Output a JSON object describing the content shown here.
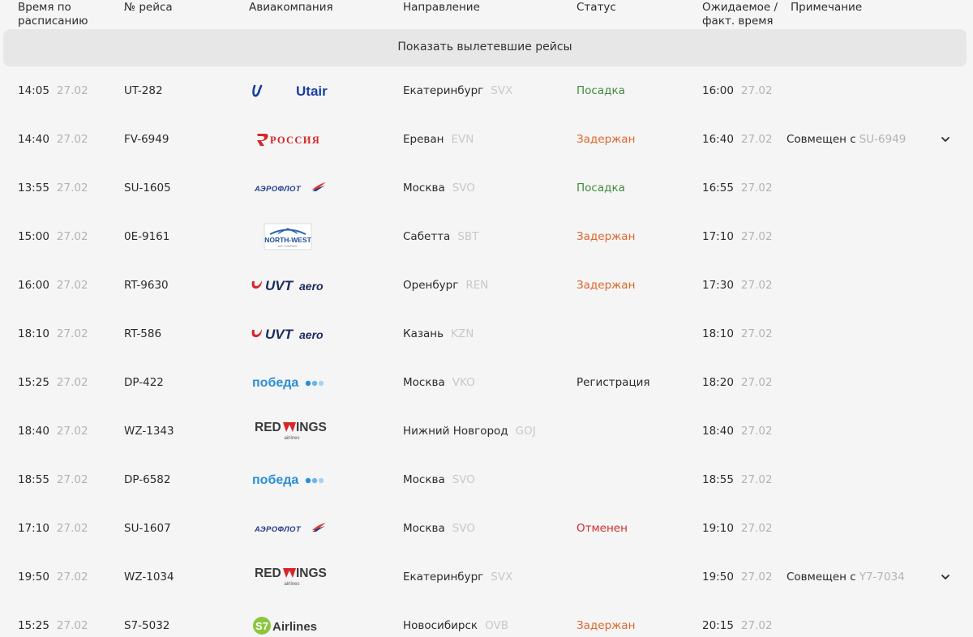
{
  "header": {
    "sched": [
      "Время по",
      "расписанию"
    ],
    "flight": "№ рейса",
    "airline": "Авиакомпания",
    "dest": "Направление",
    "status": "Статус",
    "actual": [
      "Ожидаемое /",
      "факт. время"
    ],
    "note": "Примечание"
  },
  "show_departed_label": "Показать вылетевшие рейсы",
  "colors": {
    "boarding": "#3f8a3a",
    "delayed": "#e0662a",
    "cancelled": "#d42a2a"
  },
  "rows": [
    {
      "time": "14:05",
      "date": "27.02",
      "flight": "UT-282",
      "airline": "Utair",
      "dest": "Екатеринбург",
      "code": "SVX",
      "status": "Посадка",
      "actual_time": "16:00",
      "actual_date": "27.02",
      "note": "",
      "note_code": ""
    },
    {
      "time": "14:40",
      "date": "27.02",
      "flight": "FV-6949",
      "airline": "Россия",
      "dest": "Ереван",
      "code": "EVN",
      "status": "Задержан",
      "actual_time": "16:40",
      "actual_date": "27.02",
      "note": "Совмещен с",
      "note_code": "SU-6949"
    },
    {
      "time": "13:55",
      "date": "27.02",
      "flight": "SU-1605",
      "airline": "Аэрофлот",
      "dest": "Москва",
      "code": "SVO",
      "status": "Посадка",
      "actual_time": "16:55",
      "actual_date": "27.02",
      "note": "",
      "note_code": ""
    },
    {
      "time": "15:00",
      "date": "27.02",
      "flight": "0E-9161",
      "airline": "North-West",
      "dest": "Сабетта",
      "code": "SBT",
      "status": "Задержан",
      "actual_time": "17:10",
      "actual_date": "27.02",
      "note": "",
      "note_code": ""
    },
    {
      "time": "16:00",
      "date": "27.02",
      "flight": "RT-9630",
      "airline": "UVT aero",
      "dest": "Оренбург",
      "code": "REN",
      "status": "Задержан",
      "actual_time": "17:30",
      "actual_date": "27.02",
      "note": "",
      "note_code": ""
    },
    {
      "time": "18:10",
      "date": "27.02",
      "flight": "RT-586",
      "airline": "UVT aero",
      "dest": "Казань",
      "code": "KZN",
      "status": "",
      "actual_time": "18:10",
      "actual_date": "27.02",
      "note": "",
      "note_code": ""
    },
    {
      "time": "15:25",
      "date": "27.02",
      "flight": "DP-422",
      "airline": "Победа",
      "dest": "Москва",
      "code": "VKO",
      "status": "Регистрация",
      "actual_time": "18:20",
      "actual_date": "27.02",
      "note": "",
      "note_code": ""
    },
    {
      "time": "18:40",
      "date": "27.02",
      "flight": "WZ-1343",
      "airline": "Red Wings",
      "dest": "Нижний Новгород",
      "code": "GOJ",
      "status": "",
      "actual_time": "18:40",
      "actual_date": "27.02",
      "note": "",
      "note_code": ""
    },
    {
      "time": "18:55",
      "date": "27.02",
      "flight": "DP-6582",
      "airline": "Победа",
      "dest": "Москва",
      "code": "SVO",
      "status": "",
      "actual_time": "18:55",
      "actual_date": "27.02",
      "note": "",
      "note_code": ""
    },
    {
      "time": "17:10",
      "date": "27.02",
      "flight": "SU-1607",
      "airline": "Аэрофлот",
      "dest": "Москва",
      "code": "SVO",
      "status": "Отменен",
      "actual_time": "19:10",
      "actual_date": "27.02",
      "note": "",
      "note_code": ""
    },
    {
      "time": "19:50",
      "date": "27.02",
      "flight": "WZ-1034",
      "airline": "Red Wings",
      "dest": "Екатеринбург",
      "code": "SVX",
      "status": "",
      "actual_time": "19:50",
      "actual_date": "27.02",
      "note": "Совмещен с",
      "note_code": "Y7-7034"
    },
    {
      "time": "15:25",
      "date": "27.02",
      "flight": "S7-5032",
      "airline": "S7 Airlines",
      "dest": "Новосибирск",
      "code": "OVB",
      "status": "Задержан",
      "actual_time": "20:15",
      "actual_date": "27.02",
      "note": "",
      "note_code": ""
    }
  ]
}
